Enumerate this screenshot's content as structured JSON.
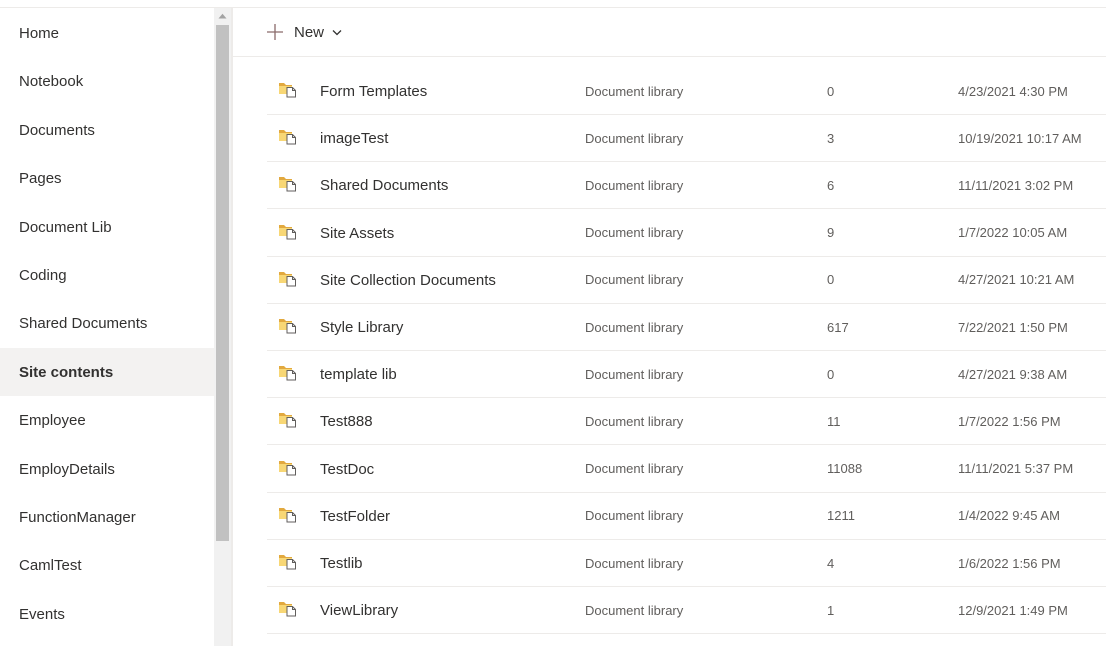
{
  "nav": {
    "items": [
      {
        "label": "Home",
        "selected": false
      },
      {
        "label": "Notebook",
        "selected": false
      },
      {
        "label": "Documents",
        "selected": false
      },
      {
        "label": "Pages",
        "selected": false
      },
      {
        "label": "Document Lib",
        "selected": false
      },
      {
        "label": "Coding",
        "selected": false
      },
      {
        "label": "Shared Documents",
        "selected": false
      },
      {
        "label": "Site contents",
        "selected": true
      },
      {
        "label": "Employee",
        "selected": false
      },
      {
        "label": "EmployDetails",
        "selected": false
      },
      {
        "label": "FunctionManager",
        "selected": false
      },
      {
        "label": "CamlTest",
        "selected": false
      },
      {
        "label": "Events",
        "selected": false
      }
    ]
  },
  "commandbar": {
    "new_label": "New",
    "new_icon": "plus-icon",
    "dropdown_icon": "chevron-down-icon"
  },
  "list": {
    "row_icon": "document-library-icon",
    "rows": [
      {
        "name": "Form Templates",
        "type": "Document library",
        "items": "0",
        "modified": "4/23/2021 4:30 PM"
      },
      {
        "name": "imageTest",
        "type": "Document library",
        "items": "3",
        "modified": "10/19/2021 10:17 AM"
      },
      {
        "name": "Shared Documents",
        "type": "Document library",
        "items": "6",
        "modified": "11/11/2021 3:02 PM"
      },
      {
        "name": "Site Assets",
        "type": "Document library",
        "items": "9",
        "modified": "1/7/2022 10:05 AM"
      },
      {
        "name": "Site Collection Documents",
        "type": "Document library",
        "items": "0",
        "modified": "4/27/2021 10:21 AM"
      },
      {
        "name": "Style Library",
        "type": "Document library",
        "items": "617",
        "modified": "7/22/2021 1:50 PM"
      },
      {
        "name": "template lib",
        "type": "Document library",
        "items": "0",
        "modified": "4/27/2021 9:38 AM"
      },
      {
        "name": "Test888",
        "type": "Document library",
        "items": "11",
        "modified": "1/7/2022 1:56 PM"
      },
      {
        "name": "TestDoc",
        "type": "Document library",
        "items": "11088",
        "modified": "11/11/2021 5:37 PM"
      },
      {
        "name": "TestFolder",
        "type": "Document library",
        "items": "1211",
        "modified": "1/4/2022 9:45 AM"
      },
      {
        "name": "Testlib",
        "type": "Document library",
        "items": "4",
        "modified": "1/6/2022 1:56 PM"
      },
      {
        "name": "ViewLibrary",
        "type": "Document library",
        "items": "1",
        "modified": "12/9/2021 1:49 PM"
      }
    ]
  },
  "colors": {
    "accent": "#0078d4",
    "selected_nav_bg": "#f3f2f1",
    "folder_fill": "#f8d775",
    "folder_dark": "#e2a93f",
    "doc_stroke": "#605e5c"
  }
}
